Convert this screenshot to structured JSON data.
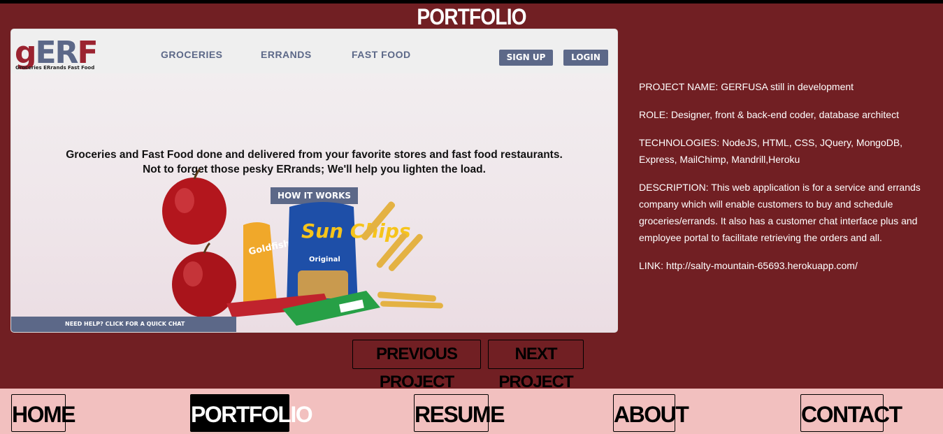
{
  "page_title": "PORTFOLIO",
  "screenshot": {
    "logo": "gERF",
    "logo_parts": {
      "g": "g",
      "er": "ER",
      "f": "F"
    },
    "logo_subtitle": "Groceries ERrands Fast Food",
    "nav": [
      "GROCERIES",
      "ERRANDS",
      "FAST FOOD"
    ],
    "signup": "SIGN UP",
    "login": "LOGIN",
    "tagline_line1": "Groceries and Fast Food done and delivered from your favorite stores and fast food restaurants.",
    "tagline_line2": "Not to forget those pesky ERrands; We'll help you lighten the load.",
    "how_it_works": "HOW IT WORKS",
    "chat_text": "NEED HELP? CLICK FOR A QUICK CHAT",
    "product_labels": {
      "goldfish": "Goldfish",
      "sunchips": "Sun Chips",
      "sunchips_flavor": "Original"
    }
  },
  "info": {
    "project_name": "PROJECT NAME: GERFUSA still in development",
    "role": "ROLE: Designer, front & back-end coder, database architect",
    "technologies": "TECHNOLOGIES: NodeJS, HTML, CSS, JQuery, MongoDB, Express, MailChimp, Mandrill,Heroku",
    "description": "DESCRIPTION: This web application is for a service and errands company which will enable customers to buy and schedule groceries/errands. It also has a customer chat interface plus and employee portal to facilitate retrieving the orders and all.",
    "link": "LINK: http://salty-mountain-65693.herokuapp.com/"
  },
  "project_nav": {
    "previous": "PREVIOUS PROJECT",
    "next": "NEXT PROJECT"
  },
  "bottom_nav": {
    "home": "HOME",
    "portfolio": "PORTFOLIO",
    "resume": "RESUME",
    "about": "ABOUT",
    "contact": "CONTACT"
  },
  "colors": {
    "background": "#711f23",
    "nav_bar": "#f2c0bf",
    "accent": "#5c6888",
    "brand_red": "#9b2330"
  }
}
